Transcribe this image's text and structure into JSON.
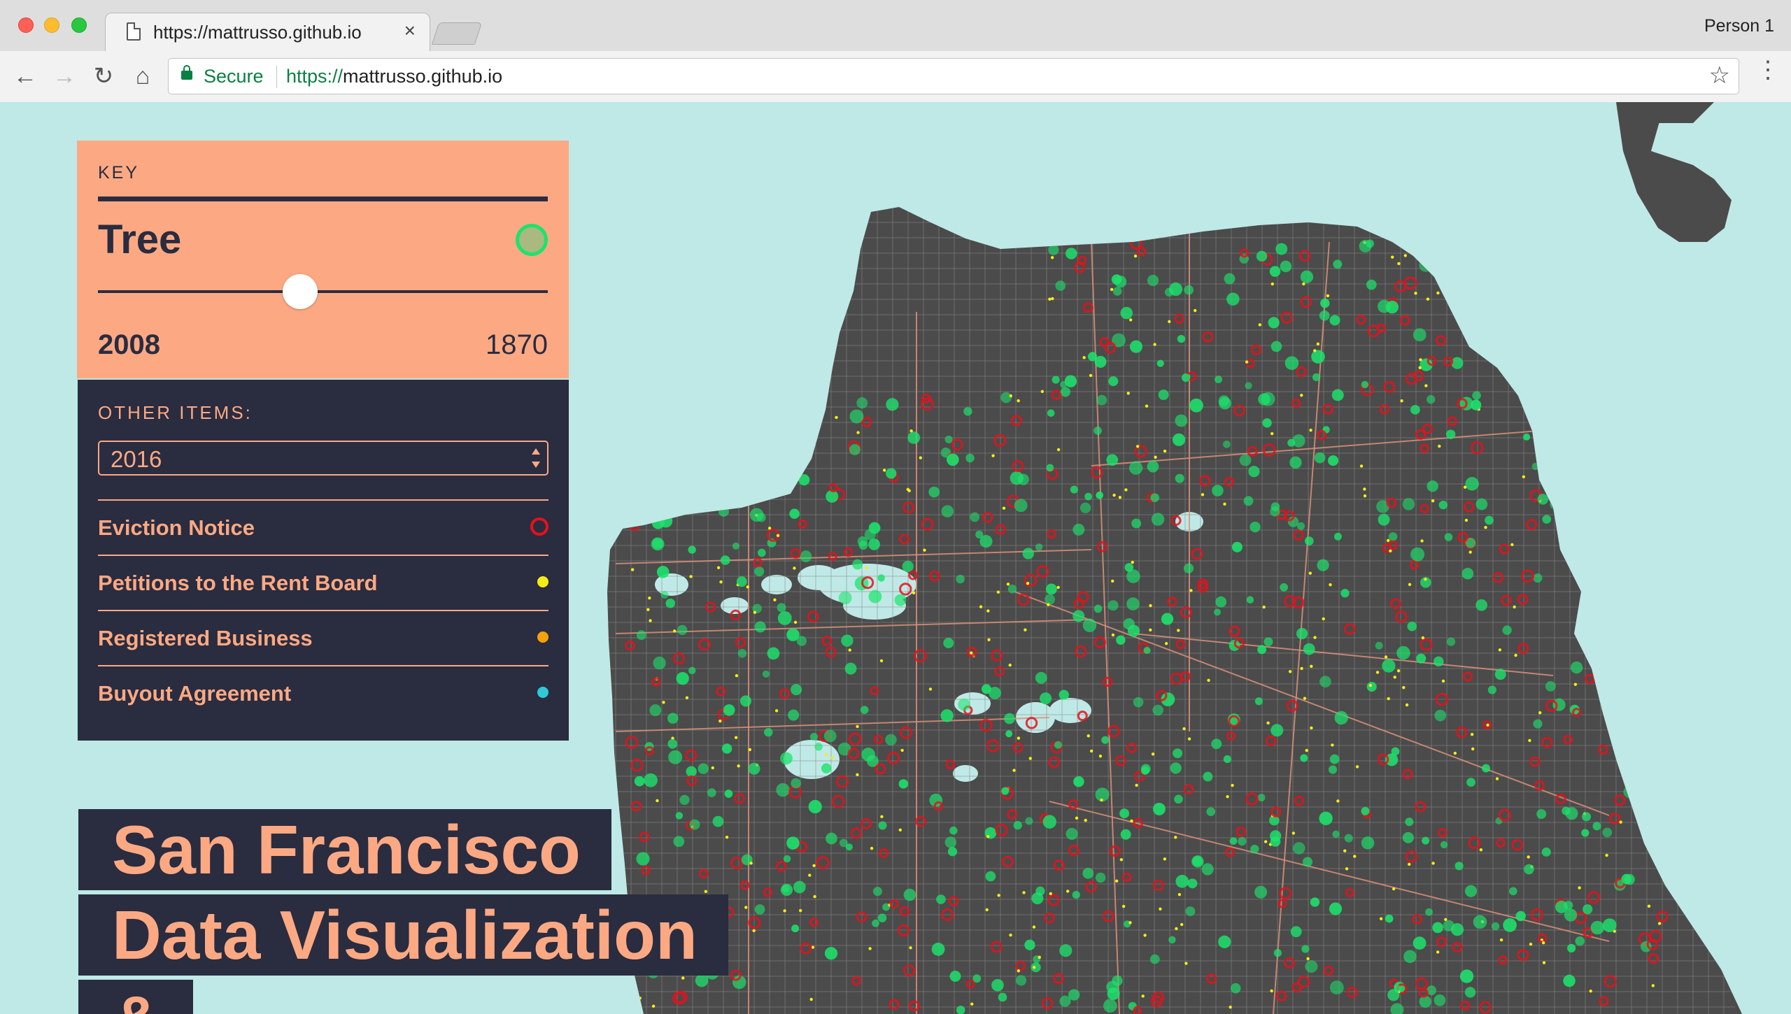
{
  "browser": {
    "tab_title": "https://mattrusso.github.io",
    "tab_close": "×",
    "profile": "Person 1",
    "secure_label": "Secure",
    "url_scheme": "https://",
    "url_host": "mattrusso.github.io",
    "icons": {
      "back": "arrow-left-icon",
      "forward": "arrow-right-icon",
      "reload": "reload-icon",
      "home": "home-icon",
      "lock": "lock-icon",
      "star": "star-icon",
      "menu": "kebab-menu-icon"
    }
  },
  "key": {
    "heading": "KEY",
    "item": "Tree",
    "year": "2008",
    "count": "1870",
    "slider_level": 0.45,
    "colors": {
      "panel": "#fca983",
      "text": "#2a2c40",
      "tree": "#1ce36c"
    }
  },
  "other": {
    "heading": "OTHER ITEMS:",
    "selected_year": "2016",
    "items": [
      {
        "label": "Eviction Notice",
        "color": "#e8101a",
        "symbol": "ring"
      },
      {
        "label": "Petitions to the Rent Board",
        "color": "#f5ee16",
        "symbol": "dot"
      },
      {
        "label": "Registered Business",
        "color": "#f5a10c",
        "symbol": "dot"
      },
      {
        "label": "Buyout Agreement",
        "color": "#2fc9d6",
        "symbol": "dot"
      }
    ]
  },
  "title": {
    "line1": "San Francisco",
    "line2": "Data Visualization",
    "line3": "&"
  },
  "map": {
    "water_color": "#bfe9e6",
    "land_color": "#4b4b4b",
    "street_color": "#8a8a8a",
    "arterial_color": "#d9917a"
  }
}
